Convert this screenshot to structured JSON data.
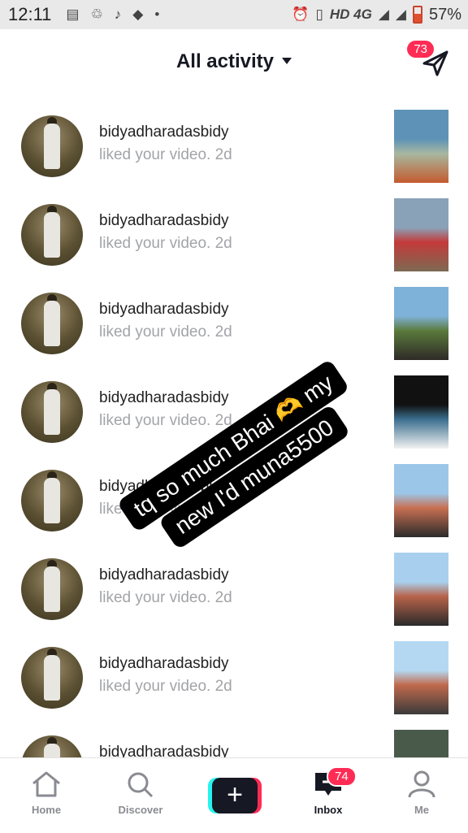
{
  "status_bar": {
    "time": "12:11",
    "network": "HD 4G",
    "battery": "57%",
    "battery_level": 0.57
  },
  "header": {
    "title": "All activity",
    "dm_badge": "73"
  },
  "activity": [
    {
      "username": "bidyadharadasbidy",
      "action": "liked your video.",
      "age": "2d",
      "thumb_colors": [
        "#5e93b7",
        "#a7b8a0",
        "#c45a2e"
      ]
    },
    {
      "username": "bidyadharadasbidy",
      "action": "liked your video.",
      "age": "2d",
      "thumb_colors": [
        "#8aa2b8",
        "#c43a3a",
        "#7c6a52"
      ]
    },
    {
      "username": "bidyadharadasbidy",
      "action": "liked your video.",
      "age": "2d",
      "thumb_colors": [
        "#7fb2d8",
        "#5a7a3c",
        "#2e2a26"
      ]
    },
    {
      "username": "bidyadharadasbidy",
      "action": "liked your video.",
      "age": "2d",
      "thumb_colors": [
        "#111111",
        "#3b6f8f",
        "#f2f2f2"
      ]
    },
    {
      "username": "bidyadharadasbidy",
      "action": "liked your video.",
      "age": "2d",
      "thumb_colors": [
        "#9cc6e8",
        "#c87052",
        "#2b2b2b"
      ]
    },
    {
      "username": "bidyadharadasbidy",
      "action": "liked your video.",
      "age": "2d",
      "thumb_colors": [
        "#a8d0ee",
        "#b8634a",
        "#2a2a2a"
      ]
    },
    {
      "username": "bidyadharadasbidy",
      "action": "liked your video.",
      "age": "2d",
      "thumb_colors": [
        "#b4d8f2",
        "#c06a4c",
        "#3a3a3a"
      ]
    },
    {
      "username": "bidyadharadasbidy",
      "action": "",
      "age": "",
      "thumb_colors": [
        "#4a5a4a",
        "#8a9a8a",
        "#2a2a2a"
      ]
    }
  ],
  "overlay_text": {
    "line1": "tq so much Bhai 🫶 my",
    "line2": "new I'd muna5500"
  },
  "tabbar": {
    "home": "Home",
    "discover": "Discover",
    "inbox": "Inbox",
    "inbox_badge": "74",
    "me": "Me"
  },
  "colors": {
    "accent": "#fe2c55",
    "cyan": "#25f4ee",
    "text_primary": "#161823",
    "text_secondary": "#a3a4a8"
  }
}
